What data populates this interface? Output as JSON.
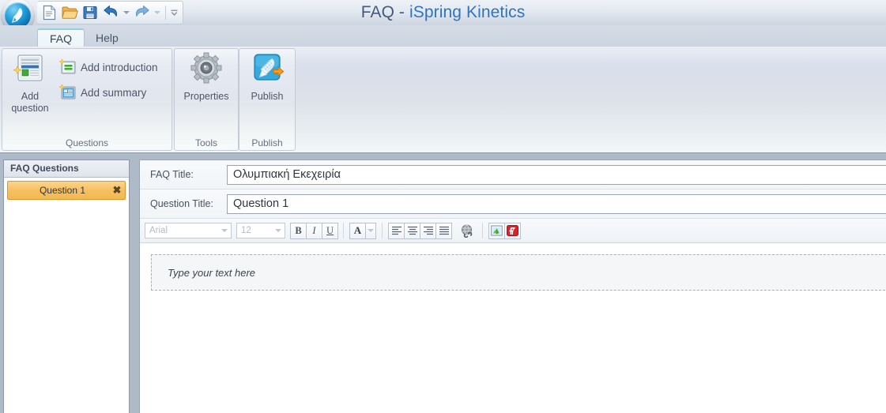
{
  "window": {
    "title_app": "FAQ",
    "title_sep": " - ",
    "title_brand": "iSpring Kinetics",
    "orb_icon": "ispring-orb-icon"
  },
  "quick_access": {
    "items": [
      {
        "name": "new-document-button",
        "icon": "new-document-icon",
        "label": "New"
      },
      {
        "name": "open-button",
        "icon": "open-folder-icon",
        "label": "Open"
      },
      {
        "name": "save-button",
        "icon": "save-floppy-icon",
        "label": "Save"
      },
      {
        "name": "undo-button",
        "icon": "undo-arrow-icon",
        "label": "Undo"
      },
      {
        "name": "undo-dropdown",
        "icon": "chevron-down-icon",
        "label": ""
      },
      {
        "name": "redo-button",
        "icon": "redo-arrow-icon",
        "label": "Redo"
      },
      {
        "name": "redo-dropdown",
        "icon": "chevron-down-icon",
        "label": ""
      },
      {
        "name": "customize-qat-button",
        "icon": "customize-chevron-icon",
        "label": ""
      }
    ]
  },
  "tabs": [
    {
      "label": "FAQ",
      "active": true
    },
    {
      "label": "Help",
      "active": false
    }
  ],
  "ribbon": {
    "groups": [
      {
        "name": "questions",
        "label": "Questions",
        "big_buttons": [
          {
            "label_line1": "Add",
            "label_line2": "question",
            "icon": "add-question-icon"
          }
        ],
        "small_buttons": [
          {
            "label": "Add introduction",
            "icon": "add-introduction-icon"
          },
          {
            "label": "Add summary",
            "icon": "add-summary-icon"
          }
        ]
      },
      {
        "name": "tools",
        "label": "Tools",
        "big_buttons": [
          {
            "label_line1": "Properties",
            "label_line2": "",
            "icon": "gear-properties-icon"
          }
        ]
      },
      {
        "name": "publish",
        "label": "Publish",
        "big_buttons": [
          {
            "label_line1": "Publish",
            "label_line2": "",
            "icon": "publish-shuttlecock-icon"
          }
        ]
      }
    ]
  },
  "sidebar": {
    "header": "FAQ Questions",
    "items": [
      {
        "label": "Question 1",
        "selected": true,
        "close_glyph": "✖"
      }
    ]
  },
  "form": {
    "faq_title_label": "FAQ Title:",
    "faq_title_value": "Ολυμπιακή Εκεχειρία",
    "question_title_label": "Question Title:",
    "question_title_value": "Question 1"
  },
  "format_toolbar": {
    "font_family": "Arial",
    "font_size": "12",
    "bold": "B",
    "italic": "I",
    "underline": "U",
    "font_color": "A",
    "align_left": "align-left-icon",
    "align_center": "align-center-icon",
    "align_right": "align-right-icon",
    "align_justify": "align-justify-icon",
    "hyperlink": "hyperlink-globe-icon",
    "insert_image": "insert-image-icon",
    "insert_flash": "insert-flash-icon"
  },
  "editor": {
    "placeholder": "Type your text here"
  },
  "colors": {
    "accent_blue": "#2f74bd",
    "selection_orange": "#f6bf61",
    "body_backdrop": "#aebac8",
    "flash_red": "#d9232b"
  }
}
